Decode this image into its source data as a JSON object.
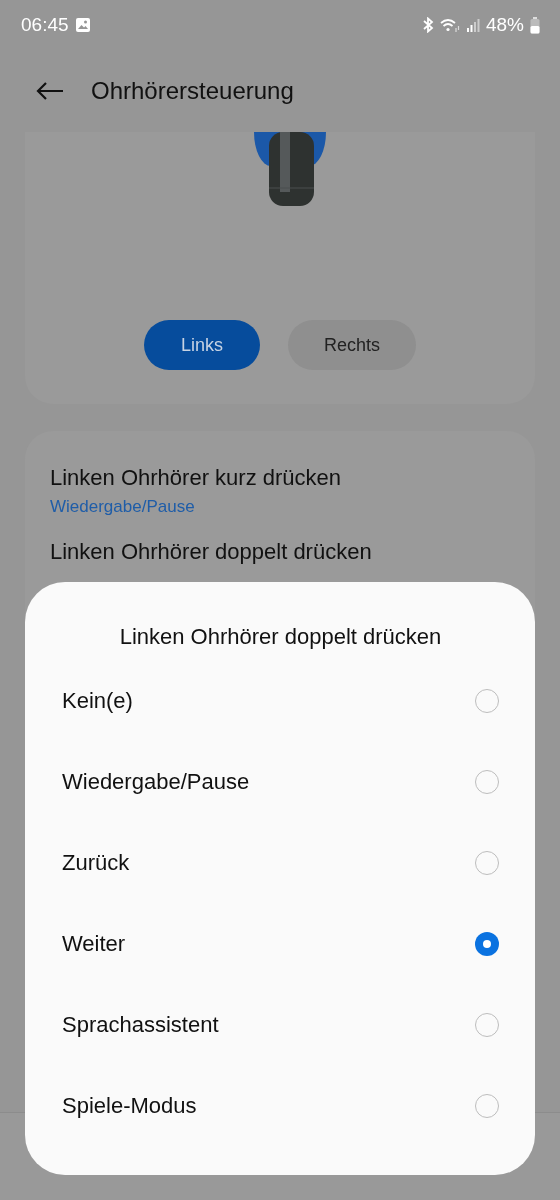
{
  "status_bar": {
    "time": "06:45",
    "battery": "48%"
  },
  "header": {
    "title": "Ohrhörersteuerung"
  },
  "earbud_sides": [
    {
      "label": "Links",
      "selected": true
    },
    {
      "label": "Rechts",
      "selected": false
    }
  ],
  "settings": [
    {
      "title": "Linken Ohrhörer kurz drücken",
      "value": "Wiedergabe/Pause"
    },
    {
      "title": "Linken Ohrhörer doppelt drücken"
    }
  ],
  "dialog": {
    "title": "Linken Ohrhörer doppelt drücken",
    "options": [
      {
        "label": "Kein(e)",
        "selected": false
      },
      {
        "label": "Wiedergabe/Pause",
        "selected": false
      },
      {
        "label": "Zurück",
        "selected": false
      },
      {
        "label": "Weiter",
        "selected": true
      },
      {
        "label": "Sprachassistent",
        "selected": false
      },
      {
        "label": "Spiele-Modus",
        "selected": false
      }
    ]
  }
}
